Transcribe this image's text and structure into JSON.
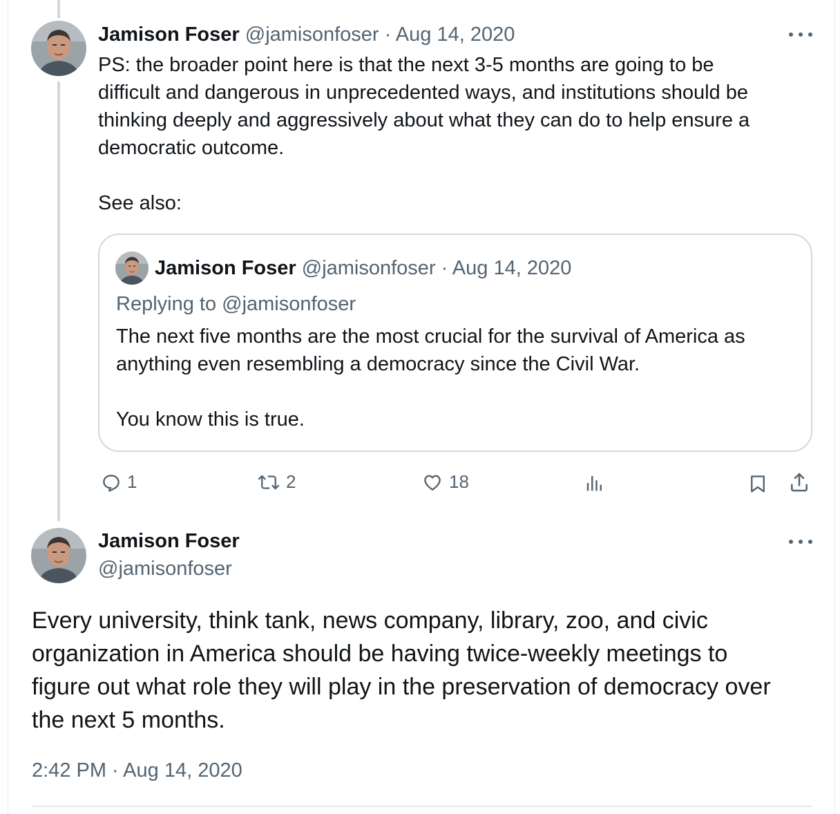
{
  "reply_tweet": {
    "author_name": "Jamison Foser",
    "handle": "@jamisonfoser",
    "separator": "·",
    "date": "Aug 14, 2020",
    "text_lines": [
      "PS: the broader point here is that the next 3-5 months are going to be",
      "difficult and dangerous in unprecedented ways, and institutions should be",
      "thinking deeply and aggressively about what they can do to help ensure a",
      "democratic outcome."
    ],
    "see_also": "See also:",
    "quoted": {
      "author_name": "Jamison Foser",
      "handle": "@jamisonfoser",
      "separator": "·",
      "date": "Aug 14, 2020",
      "replying_to": "Replying to @jamisonfoser",
      "text_lines": [
        "The next five months are the most crucial for the survival of America as",
        "anything even resembling a democracy since the Civil War."
      ],
      "text_line_2": "You know this is true."
    },
    "actions": {
      "replies": "1",
      "retweets": "2",
      "likes": "18"
    }
  },
  "main_tweet": {
    "author_name": "Jamison Foser",
    "handle": "@jamisonfoser",
    "text_lines": [
      "Every university, think tank, news company, library, zoo, and civic",
      "organization in America should be having twice-weekly meetings to",
      "figure out what role they will play in the preservation of democracy over",
      "the next 5 months."
    ],
    "timestamp": "2:42 PM · Aug 14, 2020"
  },
  "colors": {
    "text_primary": "#0f1419",
    "text_secondary": "#536471",
    "border": "#cfd9de",
    "thread_line": "#cfd9de"
  },
  "icons": [
    "more-icon",
    "reply-icon",
    "retweet-icon",
    "like-icon",
    "views-icon",
    "bookmark-icon",
    "share-icon"
  ]
}
